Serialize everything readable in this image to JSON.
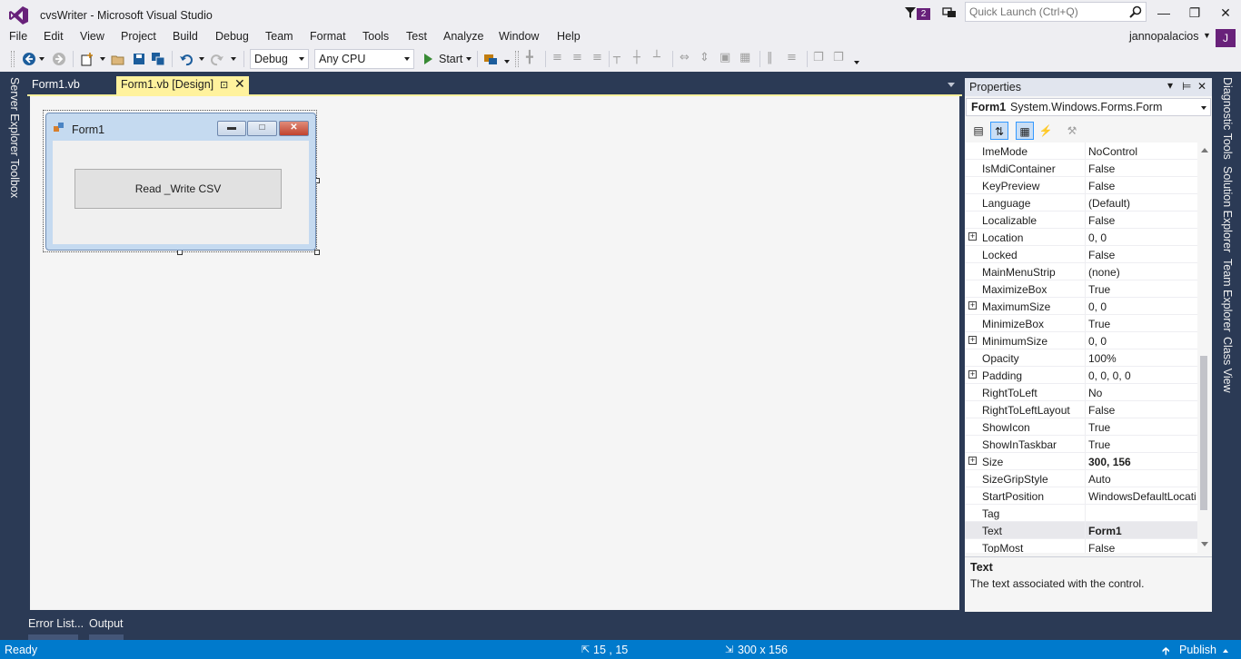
{
  "window": {
    "title": "cvsWriter - Microsoft Visual Studio",
    "notification_count": "2",
    "quick_launch_placeholder": "Quick Launch (Ctrl+Q)"
  },
  "menu": [
    "File",
    "Edit",
    "View",
    "Project",
    "Build",
    "Debug",
    "Team",
    "Format",
    "Tools",
    "Test",
    "Analyze",
    "Window",
    "Help"
  ],
  "account": {
    "user_name": "jannopalacios",
    "avatar_initial": "J"
  },
  "toolbar": {
    "configuration": "Debug",
    "platform": "Any CPU",
    "start_label": "Start"
  },
  "left_tabs": [
    "Server Explorer",
    "Toolbox"
  ],
  "right_tabs": [
    "Diagnostic Tools",
    "Solution Explorer",
    "Team Explorer",
    "Class View"
  ],
  "doc_tabs": [
    {
      "label": "Form1.vb",
      "active": false
    },
    {
      "label": "Form1.vb [Design]",
      "active": true
    }
  ],
  "designer": {
    "form_title": "Form1",
    "button_text": "Read _Write CSV"
  },
  "properties": {
    "panel_title": "Properties",
    "object_name": "Form1",
    "object_type": "System.Windows.Forms.Form",
    "rows": [
      {
        "name": "ImeMode",
        "value": "NoControl",
        "expandable": false,
        "bold": false
      },
      {
        "name": "IsMdiContainer",
        "value": "False",
        "expandable": false,
        "bold": false
      },
      {
        "name": "KeyPreview",
        "value": "False",
        "expandable": false,
        "bold": false
      },
      {
        "name": "Language",
        "value": "(Default)",
        "expandable": false,
        "bold": false
      },
      {
        "name": "Localizable",
        "value": "False",
        "expandable": false,
        "bold": false
      },
      {
        "name": "Location",
        "value": "0, 0",
        "expandable": true,
        "bold": false
      },
      {
        "name": "Locked",
        "value": "False",
        "expandable": false,
        "bold": false
      },
      {
        "name": "MainMenuStrip",
        "value": "(none)",
        "expandable": false,
        "bold": false
      },
      {
        "name": "MaximizeBox",
        "value": "True",
        "expandable": false,
        "bold": false
      },
      {
        "name": "MaximumSize",
        "value": "0, 0",
        "expandable": true,
        "bold": false
      },
      {
        "name": "MinimizeBox",
        "value": "True",
        "expandable": false,
        "bold": false
      },
      {
        "name": "MinimumSize",
        "value": "0, 0",
        "expandable": true,
        "bold": false
      },
      {
        "name": "Opacity",
        "value": "100%",
        "expandable": false,
        "bold": false
      },
      {
        "name": "Padding",
        "value": "0, 0, 0, 0",
        "expandable": true,
        "bold": false
      },
      {
        "name": "RightToLeft",
        "value": "No",
        "expandable": false,
        "bold": false
      },
      {
        "name": "RightToLeftLayout",
        "value": "False",
        "expandable": false,
        "bold": false
      },
      {
        "name": "ShowIcon",
        "value": "True",
        "expandable": false,
        "bold": false
      },
      {
        "name": "ShowInTaskbar",
        "value": "True",
        "expandable": false,
        "bold": false
      },
      {
        "name": "Size",
        "value": "300, 156",
        "expandable": true,
        "bold": true
      },
      {
        "name": "SizeGripStyle",
        "value": "Auto",
        "expandable": false,
        "bold": false
      },
      {
        "name": "StartPosition",
        "value": "WindowsDefaultLocation",
        "expandable": false,
        "bold": false
      },
      {
        "name": "Tag",
        "value": "",
        "expandable": false,
        "bold": false
      },
      {
        "name": "Text",
        "value": "Form1",
        "expandable": false,
        "bold": true,
        "selected": true
      },
      {
        "name": "TopMost",
        "value": "False",
        "expandable": false,
        "bold": false
      }
    ],
    "description_title": "Text",
    "description_text": "The text associated with the control."
  },
  "bottom_tabs": [
    "Error List...",
    "Output"
  ],
  "status": {
    "text": "Ready",
    "position": "15 , 15",
    "size": "300 x 156",
    "publish_label": "Publish"
  },
  "colors": {
    "vs_purple": "#68217a",
    "status_blue": "#007acc",
    "chrome_bg": "#eeeef2",
    "frame_dark": "#2b3a55",
    "active_tab": "#fff29d"
  }
}
